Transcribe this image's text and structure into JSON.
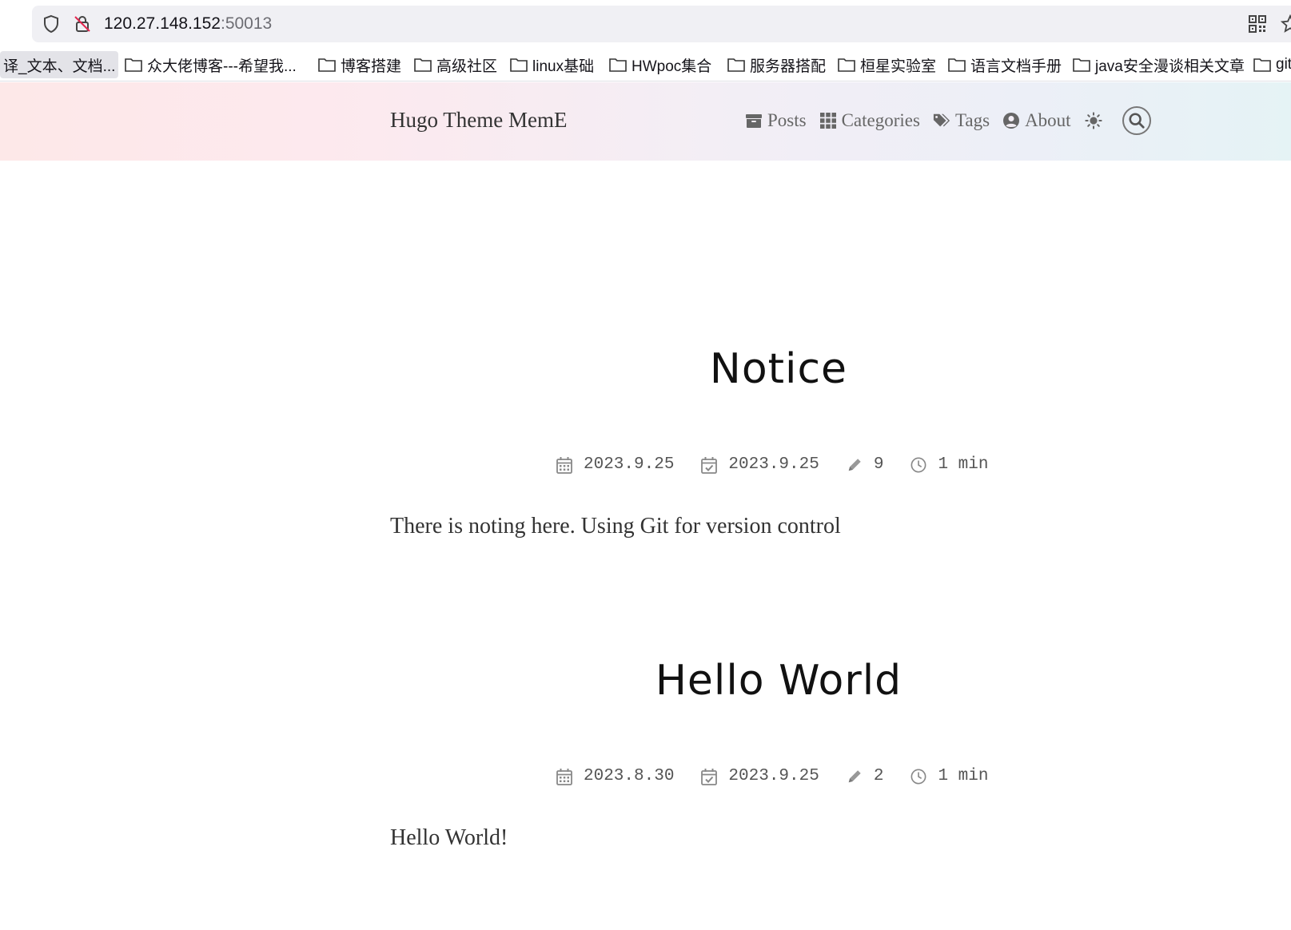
{
  "browser": {
    "url_host": "120.27.148.152",
    "url_port": ":50013",
    "bookmarks": [
      "译_文本、文档...",
      "众大佬博客---希望我...",
      "博客搭建",
      "高级社区",
      "linux基础",
      "HWpoc集合",
      "服务器搭配",
      "桓星实验室",
      "语言文档手册",
      "java安全漫谈相关文章",
      "git"
    ]
  },
  "site": {
    "title": "Hugo Theme MemE",
    "nav": {
      "posts": "Posts",
      "categories": "Categories",
      "tags": "Tags",
      "about": "About"
    }
  },
  "posts": [
    {
      "title": "Notice",
      "published": "2023.9.25",
      "updated": "2023.9.25",
      "words": "9",
      "reading_time": "1 min",
      "summary": "There is noting here. Using Git for version control"
    },
    {
      "title": "Hello World",
      "published": "2023.8.30",
      "updated": "2023.9.25",
      "words": "2",
      "reading_time": "1 min",
      "summary": "Hello World!"
    }
  ],
  "colors": {
    "header_gradient_start": "#fde8e8",
    "header_gradient_end": "#e5f3f5",
    "meta_text": "#555555",
    "title_text": "#111111"
  }
}
